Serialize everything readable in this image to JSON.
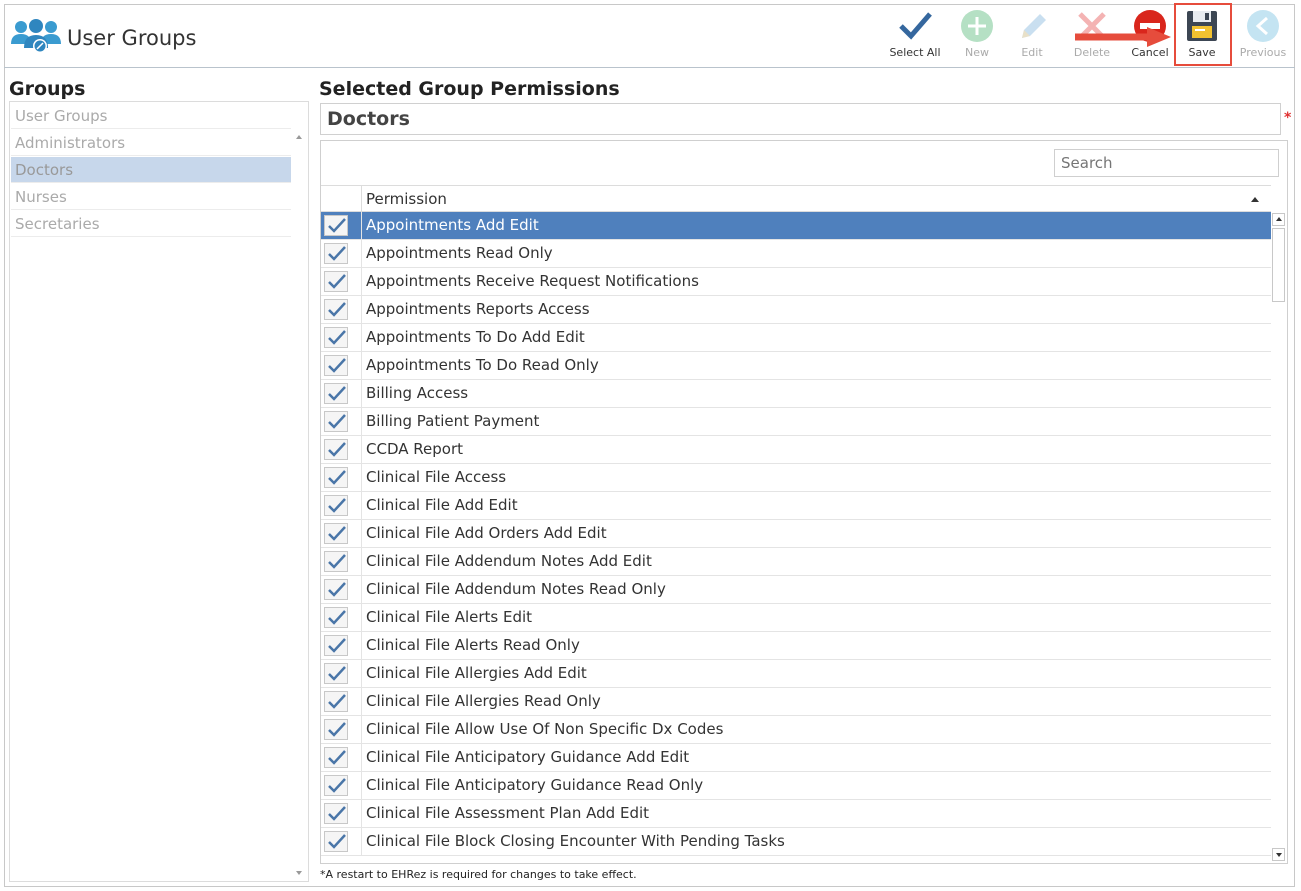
{
  "app": {
    "title": "User Groups",
    "icon": "user-group-icon"
  },
  "toolbar": {
    "select_all": "Select All",
    "new": "New",
    "edit": "Edit",
    "delete": "Delete",
    "cancel": "Cancel",
    "save": "Save",
    "previous": "Previous"
  },
  "groups": {
    "title": "Groups",
    "items": [
      "User Groups",
      "Administrators",
      "Doctors",
      "Nurses",
      "Secretaries"
    ],
    "selected": "Doctors"
  },
  "permissions_panel": {
    "title": "Selected Group Permissions",
    "group_name": "Doctors",
    "required_marker": "*",
    "search_placeholder": "Search",
    "column_header": "Permission",
    "footnote": "*A restart to EHRez is required for changes to take effect.",
    "rows": [
      "Appointments Add Edit",
      "Appointments Read Only",
      "Appointments Receive Request Notifications",
      "Appointments Reports Access",
      "Appointments To Do Add Edit",
      "Appointments To Do Read Only",
      "Billing Access",
      "Billing Patient Payment",
      "CCDA Report",
      "Clinical File Access",
      "Clinical File Add Edit",
      "Clinical File Add Orders Add Edit",
      "Clinical File Addendum Notes Add Edit",
      "Clinical File Addendum Notes Read Only",
      "Clinical File Alerts Edit",
      "Clinical File Alerts Read Only",
      "Clinical File Allergies Add Edit",
      "Clinical File Allergies Read Only",
      "Clinical File Allow Use Of Non Specific Dx Codes",
      "Clinical File Anticipatory Guidance Add Edit",
      "Clinical File Anticipatory Guidance Read Only",
      "Clinical File Assessment Plan Add Edit",
      "Clinical File Block Closing Encounter With Pending Tasks"
    ],
    "selected_row": "Appointments Add Edit"
  },
  "colors": {
    "selected_row": "#4f80bd",
    "selected_group": "#c7d7eb",
    "highlight": "#e64c3c",
    "check": "#4a76a8"
  }
}
